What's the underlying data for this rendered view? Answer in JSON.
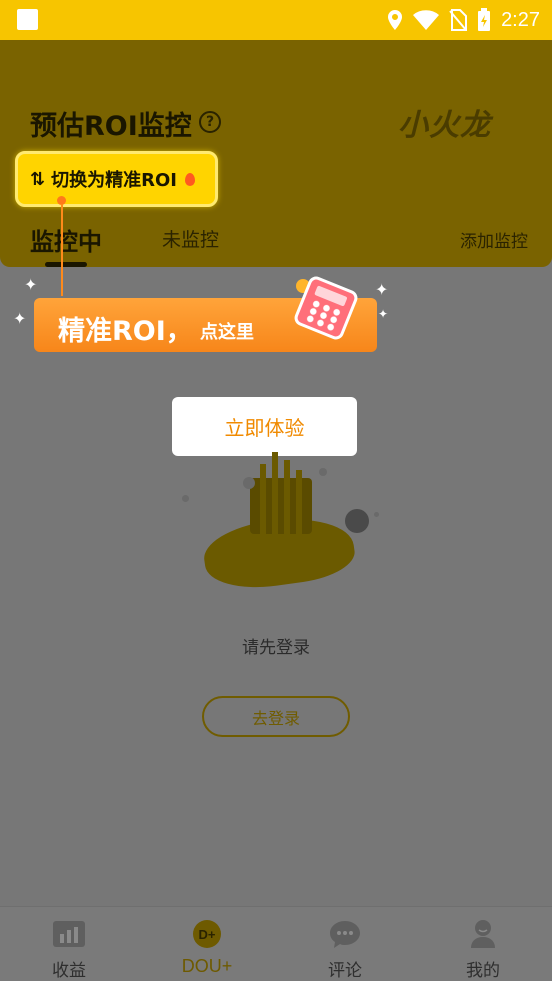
{
  "status_bar": {
    "time": "2:27"
  },
  "header": {
    "title": "预估ROI监控",
    "help_icon": "question-circle-icon",
    "brand_logo": "小火龙",
    "switch_button_label": "切换为精准ROI",
    "tabs": [
      {
        "label": "监控中",
        "active": true
      },
      {
        "label": "未监控",
        "active": false
      }
    ],
    "add_monitor_label": "添加监控"
  },
  "onboarding_tip": {
    "main_text": "精准ROI，",
    "sub_text": "点这里",
    "try_button_label": "立即体验"
  },
  "empty_state": {
    "prompt": "请先登录",
    "login_button_label": "去登录"
  },
  "bottom_nav": {
    "items": [
      {
        "label": "收益",
        "icon": "bar-chart-icon",
        "active": false
      },
      {
        "label": "DOU+",
        "icon": "dou-plus-icon",
        "active": true
      },
      {
        "label": "评论",
        "icon": "comment-bubble-icon",
        "active": false
      },
      {
        "label": "我的",
        "icon": "user-profile-icon",
        "active": false
      }
    ]
  },
  "colors": {
    "brand_yellow": "#f7c500",
    "tip_orange": "#f7861a",
    "try_button_text": "#f08a00"
  }
}
